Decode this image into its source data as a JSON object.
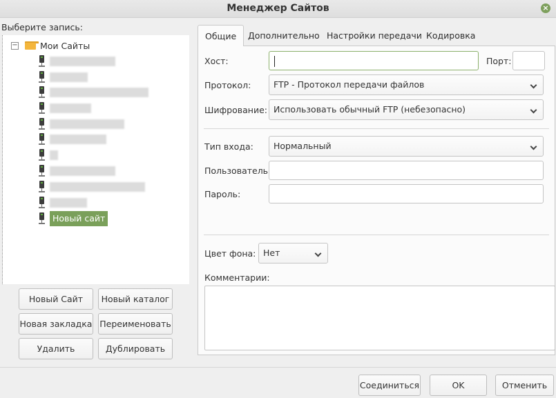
{
  "window": {
    "title": "Менеджер Сайтов",
    "close_glyph": "×"
  },
  "sidebar": {
    "label": "Выберите запись:",
    "root_label": "Мои Сайты",
    "collapse_glyph": "−",
    "new_site_label": "Новый сайт"
  },
  "buttons": {
    "new_site": "Новый Сайт",
    "new_folder": "Новый каталог",
    "new_bookmark": "Новая закладка",
    "rename": "Переименовать",
    "delete": "Удалить",
    "duplicate": "Дублировать",
    "connect": "Соединиться",
    "ok": "OK",
    "cancel": "Отменить"
  },
  "tabs": [
    {
      "label": "Общие"
    },
    {
      "label": "Дополнительно"
    },
    {
      "label": "Настройки передачи"
    },
    {
      "label": "Кодировка"
    }
  ],
  "general": {
    "host_label": "Хост:",
    "host_value": "",
    "port_label": "Порт:",
    "port_value": "",
    "protocol_label": "Протокол:",
    "protocol_value": "FTP - Протокол передачи файлов",
    "encryption_label": "Шифрование:",
    "encryption_value": "Использовать обычный FTP (небезопасно)",
    "logon_label": "Тип входа:",
    "logon_value": "Нормальный",
    "user_label": "Пользователь:",
    "user_value": "",
    "password_label": "Пароль:",
    "password_value": "",
    "bgcolor_label": "Цвет фона:",
    "bgcolor_value": "Нет",
    "comments_label": "Комментарии:",
    "comments_value": ""
  },
  "colors": {
    "accent": "#7aa05a",
    "focus_border": "#8bb06a"
  }
}
